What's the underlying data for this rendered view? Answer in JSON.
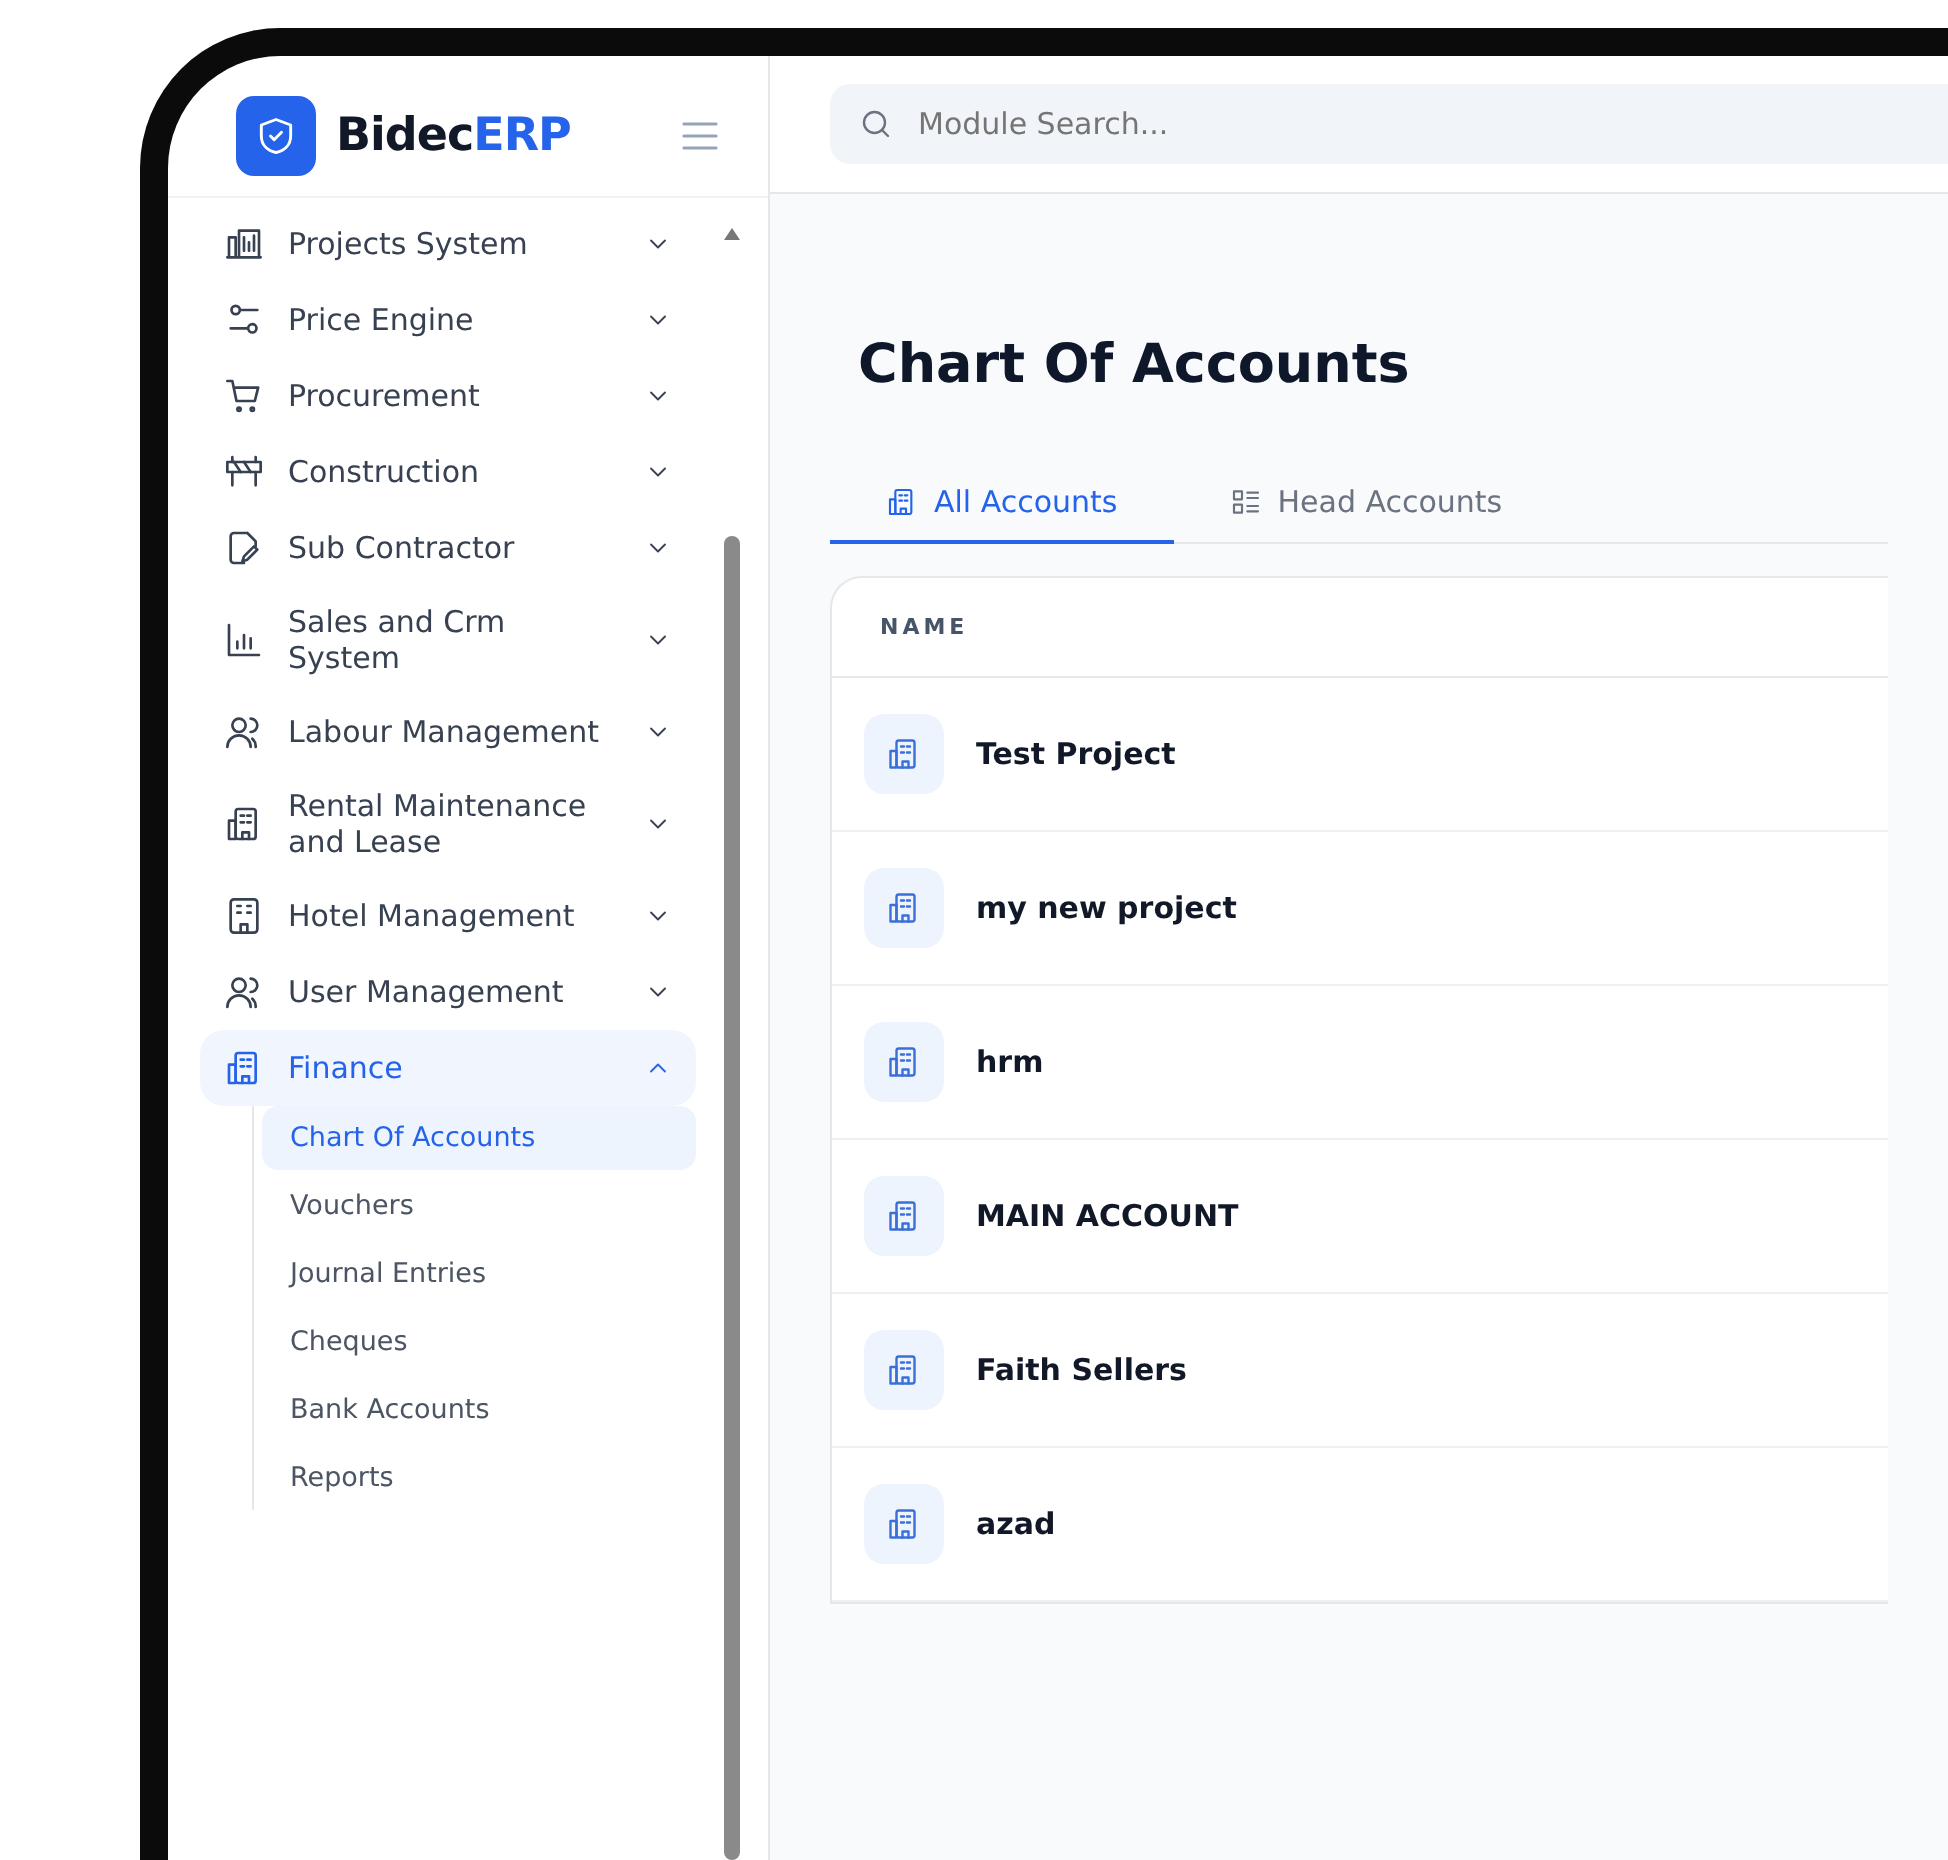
{
  "brand": {
    "name": "Bidec",
    "accent": "ERP"
  },
  "search": {
    "placeholder": "Module Search..."
  },
  "sidebar": {
    "items": [
      {
        "label": "Projects System",
        "expanded": false,
        "selected": false
      },
      {
        "label": "Price Engine",
        "expanded": false,
        "selected": false
      },
      {
        "label": "Procurement",
        "expanded": false,
        "selected": false
      },
      {
        "label": "Construction",
        "expanded": false,
        "selected": false
      },
      {
        "label": "Sub Contractor",
        "expanded": false,
        "selected": false
      },
      {
        "label": "Sales and Crm System",
        "expanded": false,
        "selected": false
      },
      {
        "label": "Labour Management",
        "expanded": false,
        "selected": false
      },
      {
        "label": "Rental Maintenance and Lease",
        "expanded": false,
        "selected": false
      },
      {
        "label": "Hotel Management",
        "expanded": false,
        "selected": false
      },
      {
        "label": "User Management",
        "expanded": false,
        "selected": false
      },
      {
        "label": "Finance",
        "expanded": true,
        "selected": true,
        "children": [
          {
            "label": "Chart Of Accounts",
            "selected": true
          },
          {
            "label": "Vouchers",
            "selected": false
          },
          {
            "label": "Journal Entries",
            "selected": false
          },
          {
            "label": "Cheques",
            "selected": false
          },
          {
            "label": "Bank Accounts",
            "selected": false
          },
          {
            "label": "Reports",
            "selected": false
          }
        ]
      }
    ]
  },
  "page": {
    "title": "Chart Of Accounts"
  },
  "tabs": [
    {
      "label": "All Accounts",
      "selected": true
    },
    {
      "label": "Head Accounts",
      "selected": false
    }
  ],
  "table": {
    "columns": [
      "NAME"
    ],
    "rows": [
      "Test Project",
      "my new project",
      "hrm",
      "MAIN ACCOUNT",
      "Faith Sellers",
      "azad"
    ]
  }
}
